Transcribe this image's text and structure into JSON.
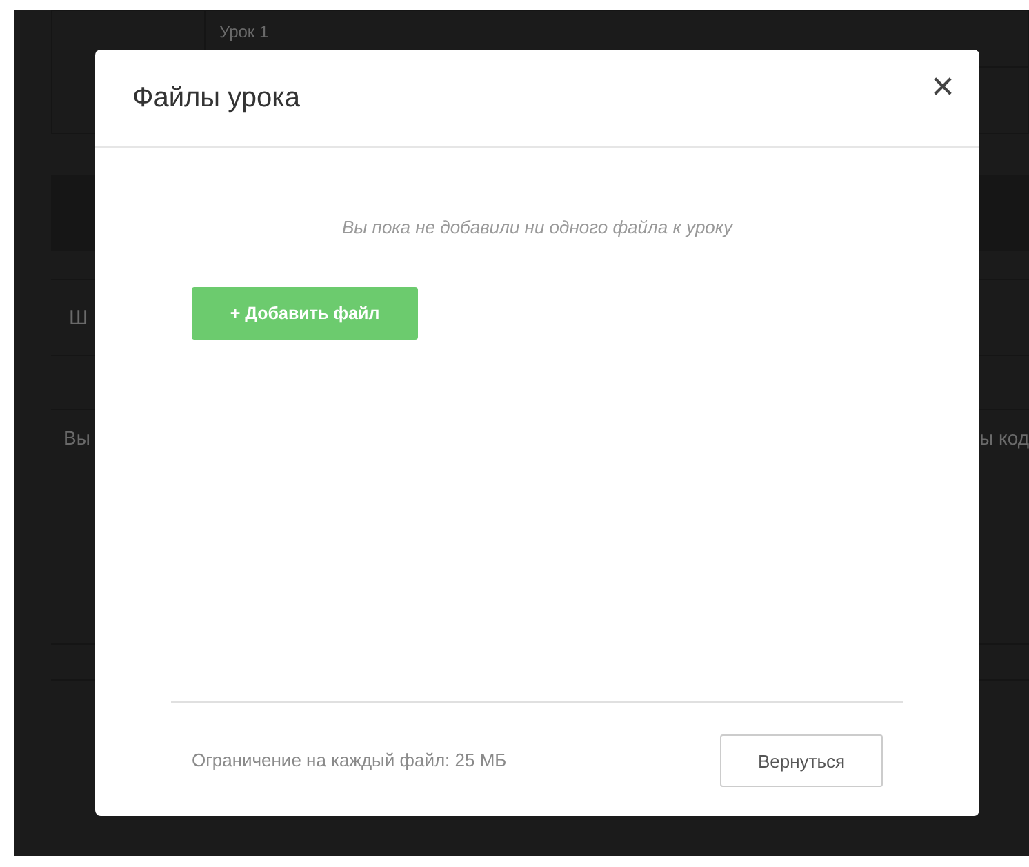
{
  "background": {
    "lesson_cell": "Урок 1",
    "section_heading": "Ш",
    "text_left": "Вы",
    "text_right": "ы код"
  },
  "modal": {
    "title": "Файлы урока",
    "empty_message": "Вы пока не добавили ни одного файла к уроку",
    "add_button": "+ Добавить файл",
    "limit_note": "Ограничение на каждый файл: 25 МБ",
    "back_button": "Вернуться"
  }
}
